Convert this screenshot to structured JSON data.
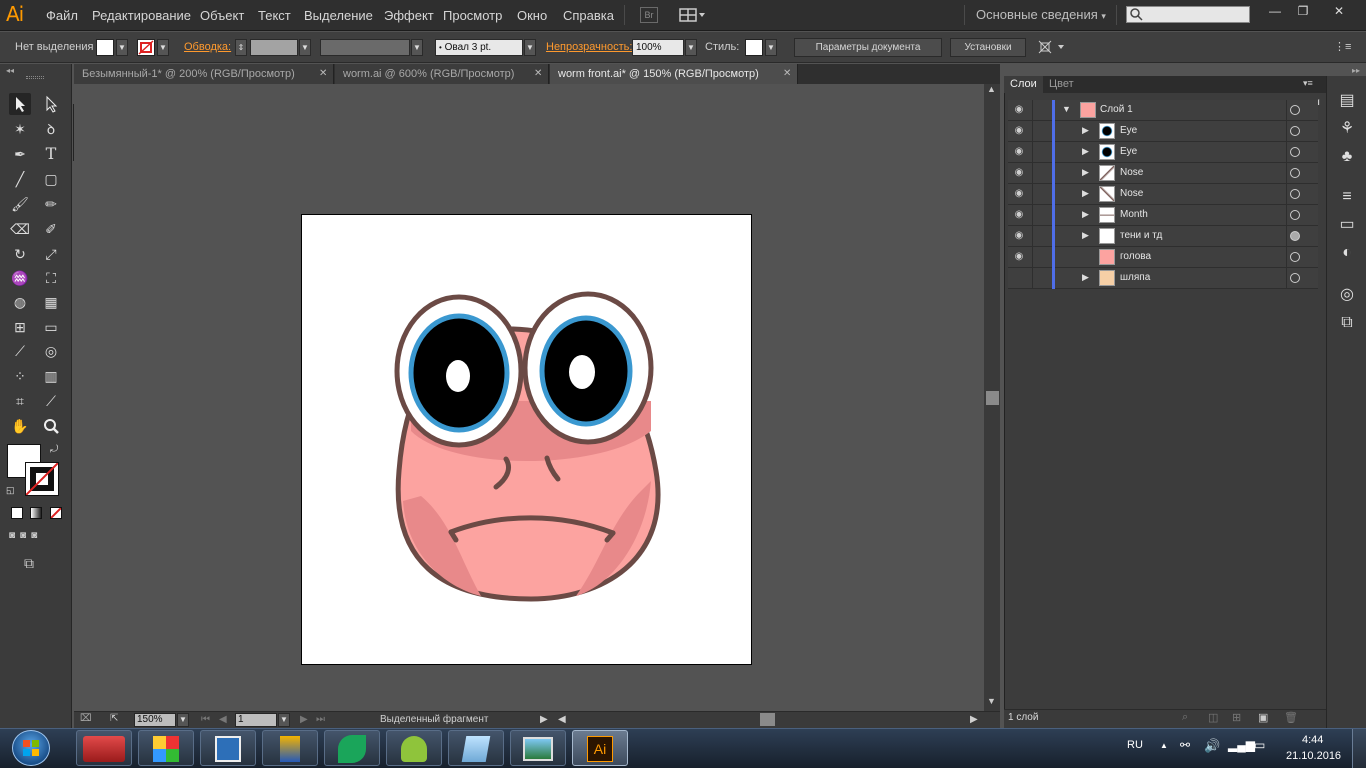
{
  "app": {
    "logo": "Ai",
    "menu": [
      "Файл",
      "Редактирование",
      "Объект",
      "Текст",
      "Выделение",
      "Эффект",
      "Просмотр",
      "Окно",
      "Справка"
    ],
    "bridge_label": "Br",
    "workspace": "Основные сведения",
    "search_placeholder": ""
  },
  "control_bar": {
    "selection_label": "Нет выделения",
    "stroke_label": "Обводка:",
    "brush_value": "Овал 3 pt.",
    "opacity_label": "Непрозрачность:",
    "opacity_value": "100%",
    "style_label": "Стиль:",
    "doc_settings_button": "Параметры документа",
    "preferences_button": "Установки"
  },
  "tabs": [
    {
      "label": "Безымянный-1* @ 200% (RGB/Просмотр)",
      "close": "✕"
    },
    {
      "label": "worm.ai @ 600% (RGB/Просмотр)",
      "close": "✕"
    },
    {
      "label": "worm front.ai* @ 150% (RGB/Просмотр)",
      "close": "✕"
    }
  ],
  "status_bar": {
    "zoom": "150%",
    "artboard_number": "1",
    "status_text": "Выделенный фрагмент"
  },
  "layers_panel": {
    "tabs": [
      "Слои",
      "Цвет"
    ],
    "layers": [
      {
        "name": "Слой 1",
        "level": 0,
        "expanded": true
      },
      {
        "name": "Eye",
        "level": 1
      },
      {
        "name": "Eye",
        "level": 1
      },
      {
        "name": "Nose",
        "level": 1
      },
      {
        "name": "Nose",
        "level": 1
      },
      {
        "name": "Month",
        "level": 1
      },
      {
        "name": "тени и тд",
        "level": 1
      },
      {
        "name": "голова",
        "level": 1
      },
      {
        "name": "шляпа",
        "level": 1
      }
    ],
    "footer_text": "1 слой"
  },
  "taskbar": {
    "language": "RU",
    "time": "4:44",
    "date": "21.10.2016",
    "illustrator_label": "Ai"
  },
  "colors": {
    "accent_orange": "#ff9a00",
    "layer_color": "#4f6ee8",
    "face_pink": "#fca3a0",
    "face_shadow": "#e8898a",
    "outline_brown": "#6b4a45",
    "iris_blue": "#3a98d0"
  }
}
